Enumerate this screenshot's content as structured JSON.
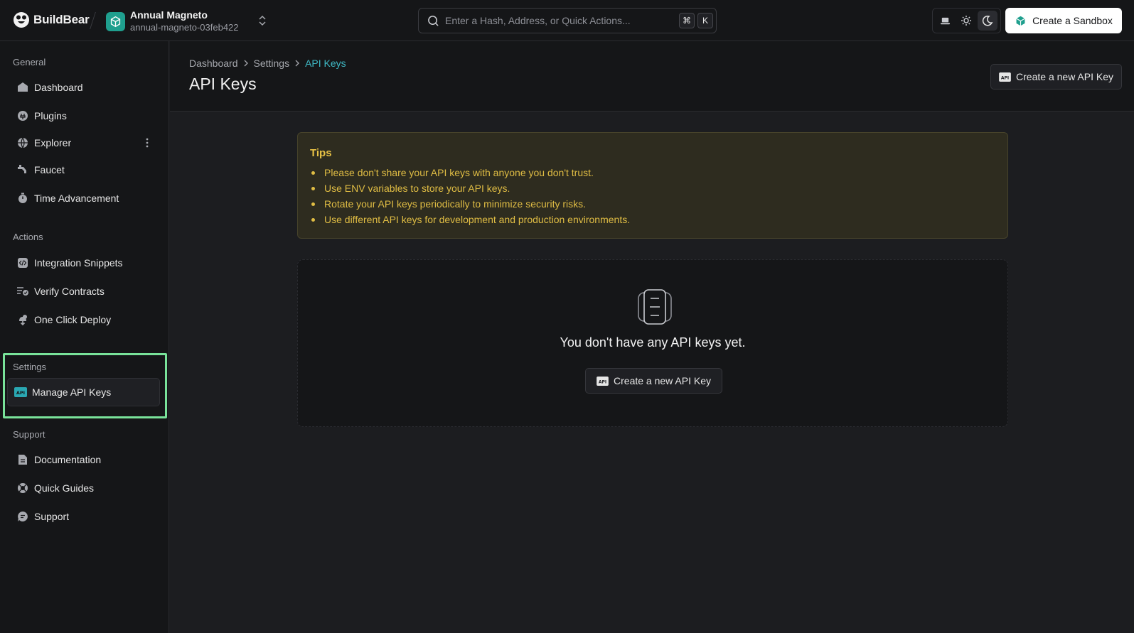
{
  "topbar": {
    "brand_name": "BuildBear",
    "project_name": "Annual Magneto",
    "project_slug": "annual-magneto-03feb422",
    "search_placeholder": "Enter a Hash, Address, or Quick Actions...",
    "kbd_cmd": "⌘",
    "kbd_key": "K",
    "create_sandbox_label": "Create a Sandbox"
  },
  "sidebar": {
    "general_title": "General",
    "general_items": [
      {
        "label": "Dashboard",
        "icon": "dashboard-icon"
      },
      {
        "label": "Plugins",
        "icon": "plugins-icon"
      },
      {
        "label": "Explorer",
        "icon": "globe-icon"
      },
      {
        "label": "Faucet",
        "icon": "faucet-icon"
      },
      {
        "label": "Time Advancement",
        "icon": "stopwatch-icon"
      }
    ],
    "actions_title": "Actions",
    "actions_items": [
      {
        "label": "Integration Snippets",
        "icon": "code-icon"
      },
      {
        "label": "Verify Contracts",
        "icon": "verify-icon"
      },
      {
        "label": "One Click Deploy",
        "icon": "deploy-icon"
      }
    ],
    "settings_title": "Settings",
    "settings_items": [
      {
        "label": "Manage API Keys",
        "icon": "api-icon",
        "active": true
      }
    ],
    "support_title": "Support",
    "support_items": [
      {
        "label": "Documentation",
        "icon": "document-icon"
      },
      {
        "label": "Quick Guides",
        "icon": "lifebuoy-icon"
      },
      {
        "label": "Support",
        "icon": "chat-icon"
      }
    ]
  },
  "header": {
    "breadcrumb": [
      "Dashboard",
      "Settings",
      "API Keys"
    ],
    "title": "API Keys",
    "create_button_label": "Create a new API Key"
  },
  "tips": {
    "title": "Tips",
    "items": [
      "Please don't share your API keys with anyone you don't trust.",
      "Use ENV variables to store your API keys.",
      "Rotate your API keys periodically to minimize security risks.",
      "Use different API keys for development and production environments."
    ]
  },
  "empty_state": {
    "message": "You don't have any API keys yet.",
    "button_label": "Create a new API Key"
  },
  "colors": {
    "accent": "#3fb8c4",
    "highlight": "#79e39a",
    "tips_text": "#e0bd44"
  }
}
